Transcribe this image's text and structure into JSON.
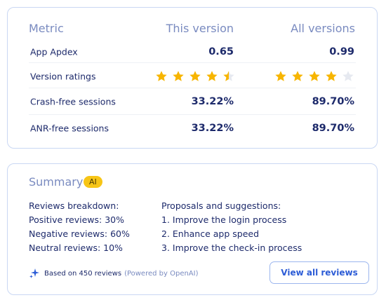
{
  "metrics": {
    "header": {
      "metric": "Metric",
      "this_version": "This version",
      "all_versions": "All versions"
    },
    "rows": [
      {
        "label": "App Apdex",
        "this_version": "0.65",
        "all_versions": "0.99"
      },
      {
        "label": "Version ratings",
        "this_version_rating": 4.5,
        "all_versions_rating": 4,
        "max_rating": 5
      },
      {
        "label": "Crash-free sessions",
        "this_version": "33.22%",
        "all_versions": "89.70%"
      },
      {
        "label": "ANR-free sessions",
        "this_version": "33.22%",
        "all_versions": "89.70%"
      }
    ]
  },
  "summary": {
    "title": "Summary",
    "badge": "AI",
    "breakdown": {
      "heading": "Reviews breakdown:",
      "positive": "Positive reviews: 30%",
      "negative": "Negative reviews: 60%",
      "neutral": "Neutral reviews: 10%"
    },
    "proposals": {
      "heading": "Proposals and suggestions:",
      "items": [
        "1. Improve the login process",
        "2. Enhance app speed",
        "3. Improve the check-in process"
      ]
    },
    "footer": {
      "text": "Based on 450 reviews",
      "powered": "(Powered by OpenAI)"
    },
    "view_all_label": "View all reviews"
  },
  "colors": {
    "star_filled": "#f7b500",
    "star_empty": "#e6e9f0",
    "accent": "#2c5cd6",
    "badge": "#f7c516"
  }
}
